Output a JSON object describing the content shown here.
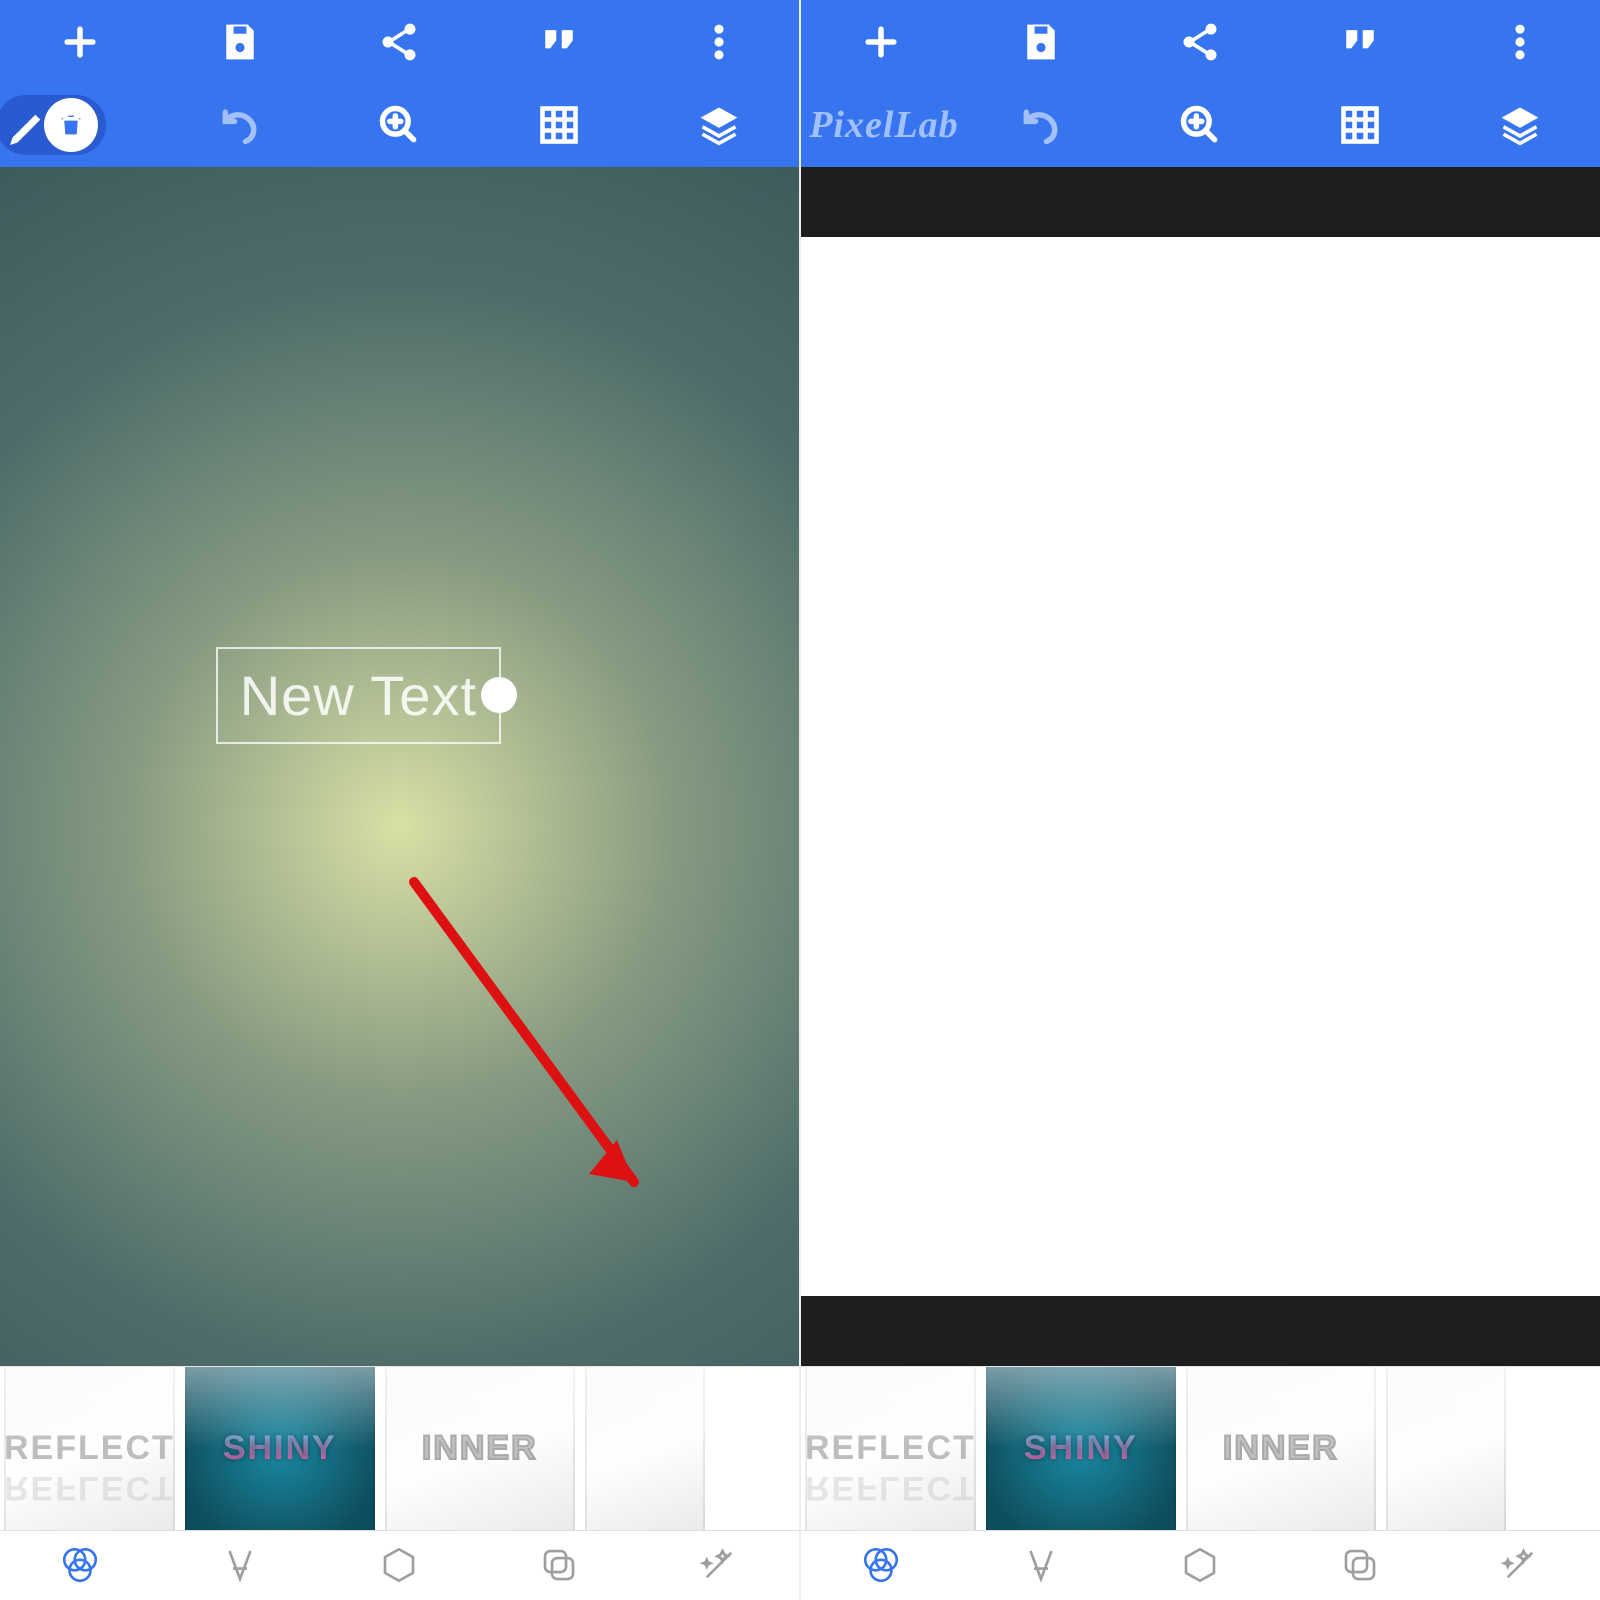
{
  "app_name": "PixelLab",
  "canvas_text": "New Text",
  "presets": {
    "reflect_label": "REFLECT",
    "shiny_label": "SHINY",
    "inner_label": "INNER"
  },
  "toolbar": {
    "add": "add",
    "save": "save",
    "share": "share",
    "quote": "quote",
    "overflow": "overflow",
    "undo": "undo",
    "zoom": "zoom",
    "grid": "grid",
    "layers": "layers"
  },
  "tabs": {
    "filters": "filters",
    "text": "text",
    "shapes": "shapes",
    "layers": "layers",
    "effects": "effects"
  }
}
